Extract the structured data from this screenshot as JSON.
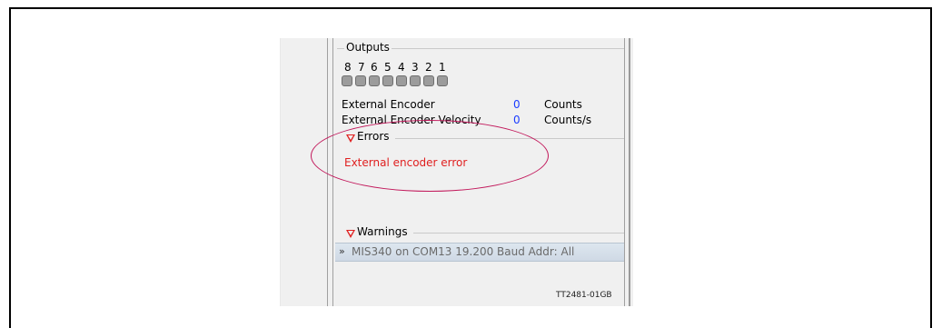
{
  "outputs": {
    "title": "Outputs",
    "channels": [
      "8",
      "7",
      "6",
      "5",
      "4",
      "3",
      "2",
      "1"
    ]
  },
  "readouts": [
    {
      "label": "External Encoder",
      "value": "0",
      "unit": "Counts"
    },
    {
      "label": "External Encoder Velocity",
      "value": "0",
      "unit": "Counts/s"
    }
  ],
  "errors": {
    "title": "Errors",
    "messages": [
      "External encoder error"
    ]
  },
  "warnings": {
    "title": "Warnings"
  },
  "status_bar": {
    "text": "MIS340 on COM13 19.200 Baud Addr: All"
  },
  "figure_code": "TT2481-01GB",
  "colors": {
    "error_text": "#e02020",
    "value_text": "#1a3cff",
    "highlight_ellipse": "#c2185b"
  }
}
